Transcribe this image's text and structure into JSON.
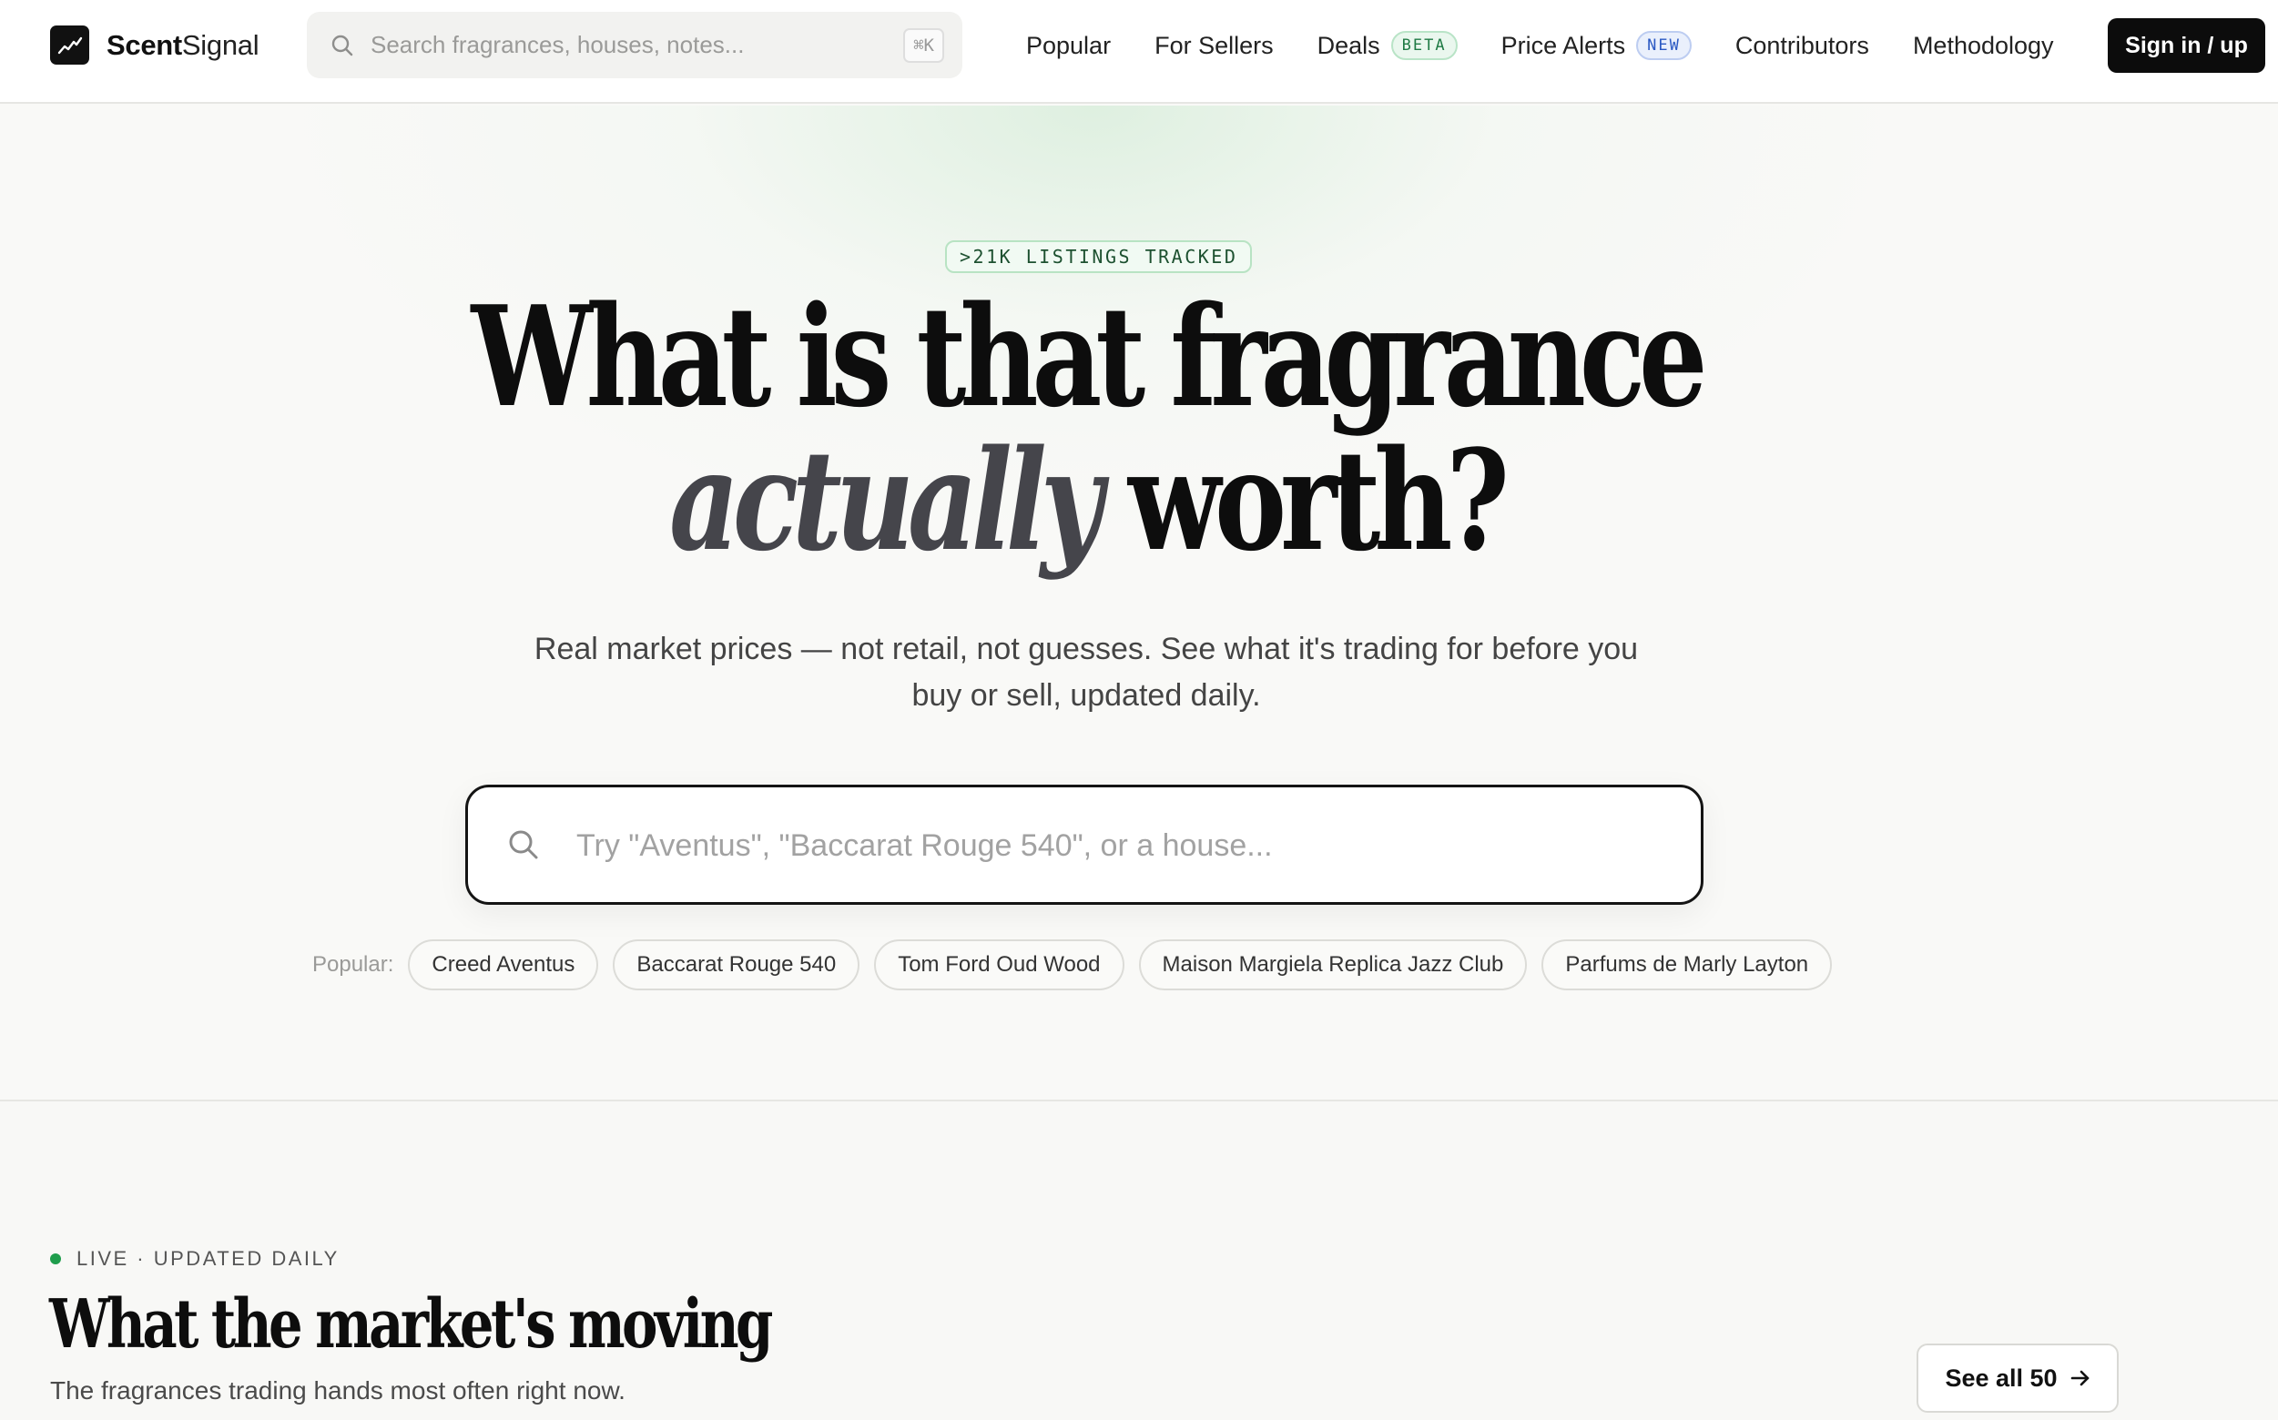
{
  "brand": {
    "name_bold": "Scent",
    "name_regular": "Signal"
  },
  "nav_search": {
    "placeholder": "Search fragrances, houses, notes...",
    "shortcut": "⌘K"
  },
  "nav": {
    "popular": "Popular",
    "for_sellers": "For Sellers",
    "deals": "Deals",
    "deals_badge": "BETA",
    "price_alerts": "Price Alerts",
    "price_alerts_badge": "NEW",
    "contributors": "Contributors",
    "methodology": "Methodology",
    "sign_in": "Sign in / up"
  },
  "hero": {
    "badge": ">21K LISTINGS TRACKED",
    "headline_line1": "What is that fragrance",
    "headline_emphasis": "actually",
    "headline_line2_rest": "worth?",
    "subtitle": "Real market prices — not retail, not guesses. See what it's trading for before you buy or sell, updated daily.",
    "search_placeholder": "Try \"Aventus\", \"Baccarat Rouge 540\", or a house...",
    "popular_label": "Popular:",
    "popular_chips": [
      "Creed Aventus",
      "Baccarat Rouge 540",
      "Tom Ford Oud Wood",
      "Maison Margiela Replica Jazz Club",
      "Parfums de Marly Layton"
    ]
  },
  "market": {
    "live_label": "LIVE · UPDATED DAILY",
    "title": "What the market's moving",
    "subtitle": "The fragrances trading hands most often right now.",
    "see_all": "See all 50"
  },
  "colors": {
    "accent_green": "#1f9d4c",
    "beta_green": "#1f7a44",
    "new_blue": "#2b59c3",
    "primary_button": "#0c0c0c"
  },
  "icons": {
    "logo": "trend-line-icon",
    "search": "search-icon",
    "arrow": "arrow-right-icon"
  }
}
